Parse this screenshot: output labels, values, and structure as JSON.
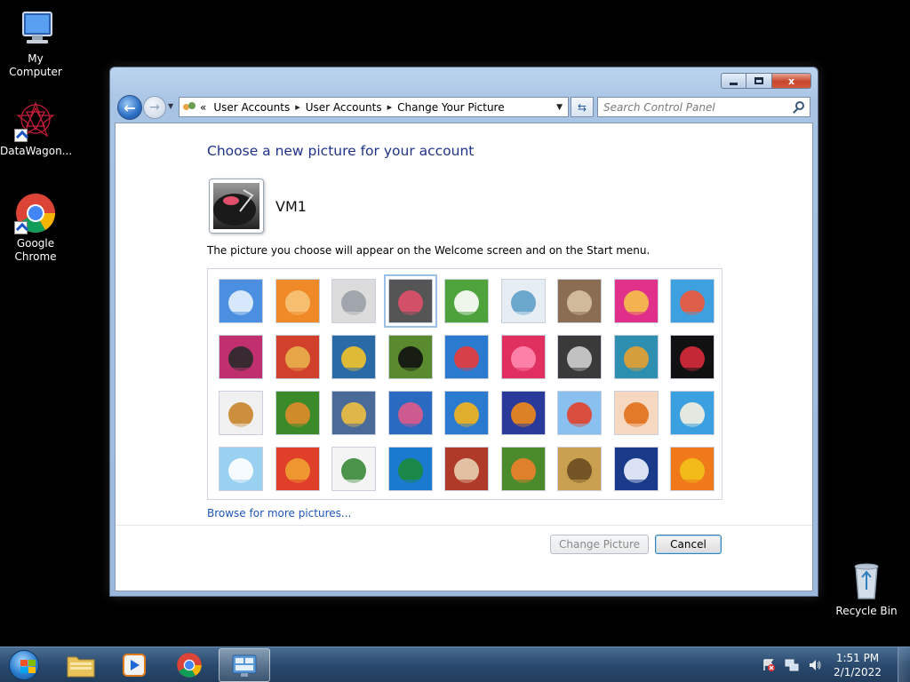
{
  "desktop": {
    "icons": [
      {
        "label": "My Computer"
      },
      {
        "label": "DataWagon..."
      },
      {
        "label": "Google Chrome"
      },
      {
        "label": "Recycle Bin"
      }
    ]
  },
  "window": {
    "controls": {
      "minimize": "minimize",
      "maximize": "maximize",
      "close": "x"
    },
    "breadcrumb": {
      "overflow": "«",
      "items": [
        "User Accounts",
        "User Accounts",
        "Change Your Picture"
      ],
      "separator": "▸"
    },
    "search": {
      "placeholder": "Search Control Panel"
    }
  },
  "content": {
    "heading": "Choose a new picture for your account",
    "account_name": "VM1",
    "description": "The picture you choose will appear on the Welcome screen and on the Start menu.",
    "browse_link": "Browse for more pictures...",
    "buttons": {
      "change_picture": "Change Picture",
      "cancel": "Cancel"
    },
    "pictures": [
      [
        "roller-coaster",
        "starfish",
        "robot-toy",
        "turntable",
        "lucky-cat",
        "spinning-top",
        "kitten",
        "pink-flower",
        "ferris-wheel"
      ],
      [
        "ball",
        "fabric",
        "leaf",
        "dog",
        "crayons",
        "paper-star",
        "jacks",
        "stairs",
        "paper-crane"
      ],
      [
        "guitar",
        "pomeranian",
        "robot",
        "scarf",
        "sunflower",
        "fish",
        "hot-air-balloon",
        "doll",
        "sailboat"
      ],
      [
        "soccer-ball",
        "stripes",
        "marbles",
        "window",
        "pattern",
        "butterfly",
        "wicker",
        "lighthouse",
        "daisy"
      ]
    ],
    "selected_picture": "turntable"
  },
  "taskbar": {
    "clock_time": "1:51 PM",
    "clock_date": "2/1/2022"
  }
}
